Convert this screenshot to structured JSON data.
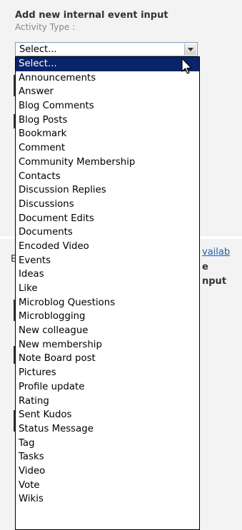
{
  "section": {
    "heading": "Add new internal event input",
    "field_label": "Activity Type :"
  },
  "dropdown": {
    "selected": "Select...",
    "options": [
      "Select...",
      "Announcements",
      "Answer",
      "Blog Comments",
      "Blog Posts",
      "Bookmark",
      "Comment",
      "Community Membership",
      "Contacts",
      "Discussion Replies",
      "Discussions",
      "Document Edits",
      "Documents",
      "Encoded Video",
      "Events",
      "Ideas",
      "Like",
      "Microblog Questions",
      "Microblogging",
      "New colleague",
      "New membership",
      "Note Board post",
      "Pictures",
      "Profile update",
      "Rating",
      "Sent Kudos",
      "Status Message",
      "Tag",
      "Tasks",
      "Video",
      "Vote",
      "Wikis"
    ]
  },
  "background_fragments": {
    "left_letter": "E",
    "link_fragment": "vailab",
    "text_fragment_1": "e",
    "text_fragment_2": "nput"
  },
  "colors": {
    "selected_bg": "#0a246a",
    "link": "#1a5fb4",
    "heading": "#333333",
    "label": "#888888"
  }
}
